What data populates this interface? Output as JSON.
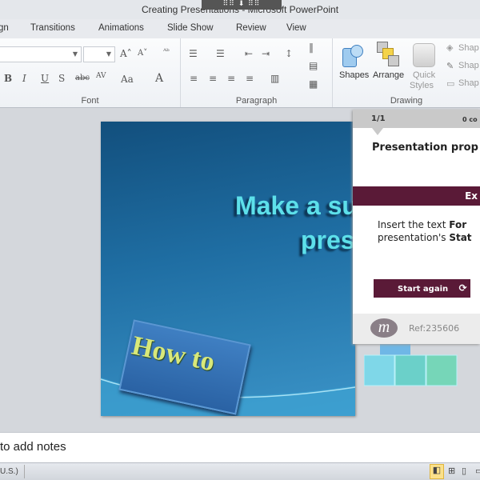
{
  "window": {
    "title": "Creating Presentations - Microsoft PowerPoint",
    "grip": "⠿⠿ ⬇ ⠿⠿"
  },
  "tabs": [
    "gn",
    "Transitions",
    "Animations",
    "Slide Show",
    "Review",
    "View"
  ],
  "ribbon": {
    "font_group": "Font",
    "paragraph_group": "Paragraph",
    "drawing_group": "Drawing",
    "shapes": "Shapes",
    "arrange": "Arrange",
    "quick_styles_1": "Quick",
    "quick_styles_2": "Styles",
    "shape_fill": "Shap",
    "shape_outline": "Shap",
    "shape_effects": "Shap"
  },
  "slide": {
    "title_line1": "Make a su",
    "title_line2": "pres",
    "howto": "How to"
  },
  "panel": {
    "progress": "1/1",
    "completed": "0 co",
    "title": "Presentation prop",
    "bar_label": "Ex",
    "text_line1_pre": "Insert the text ",
    "text_line1_bold": "For",
    "text_line2_pre": "presentation's ",
    "text_line2_bold": "Stat",
    "button": "Start again",
    "ref": "Ref:235606",
    "logo": "m"
  },
  "notes": {
    "placeholder": "to add notes"
  },
  "status": {
    "language": "U.S.)"
  },
  "colors": {
    "accent": "#5a1a37",
    "slide_title": "#5de0ea"
  }
}
